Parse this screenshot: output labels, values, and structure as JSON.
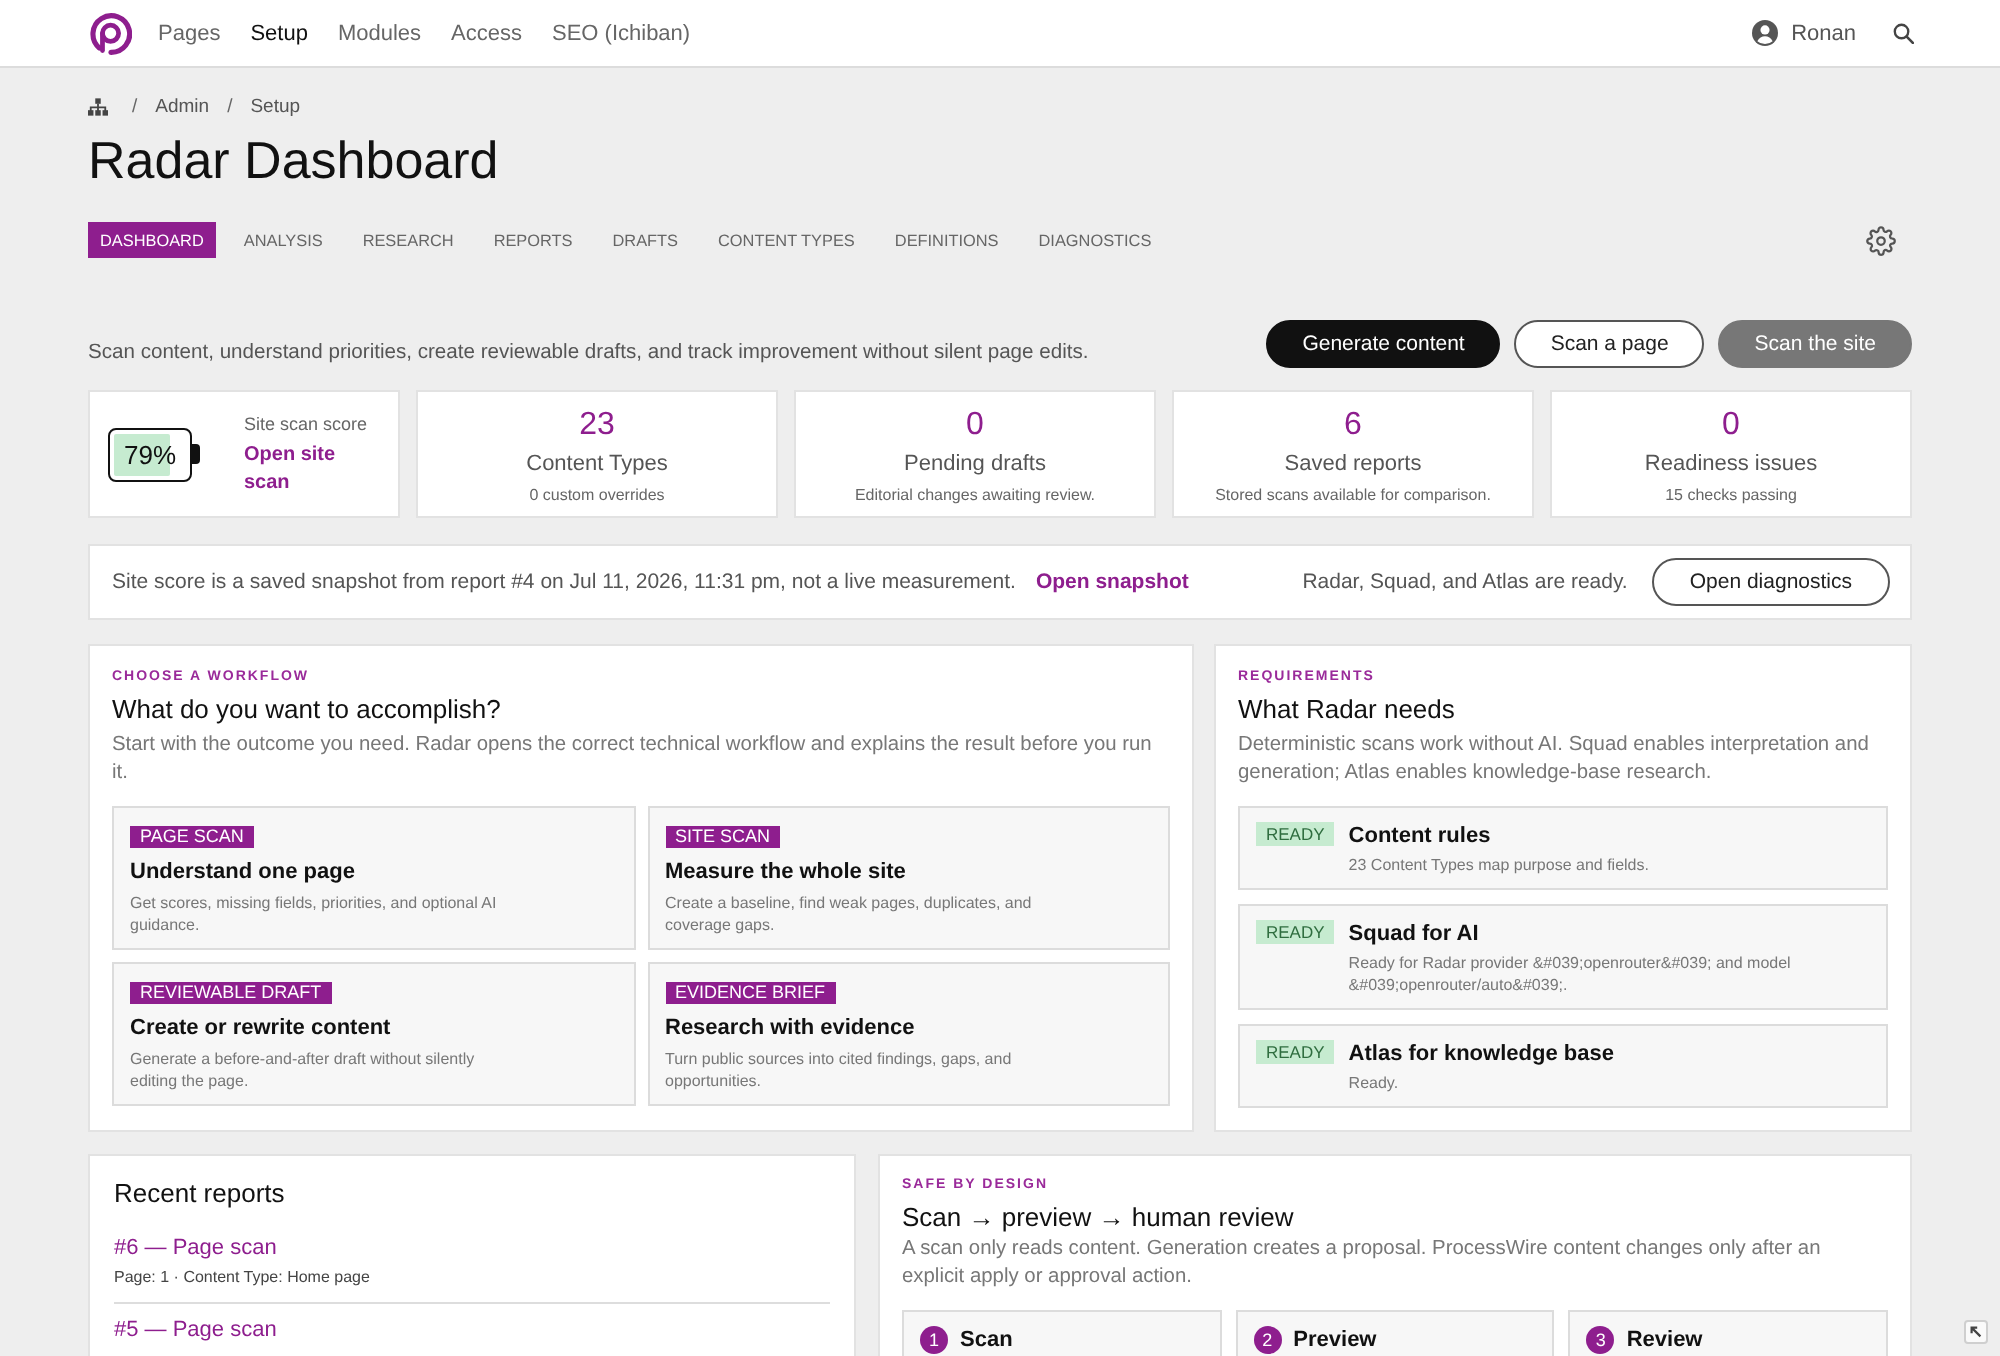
{
  "top_nav": {
    "items": [
      {
        "label": "Pages",
        "selected": false
      },
      {
        "label": "Setup",
        "selected": true
      },
      {
        "label": "Modules",
        "selected": false
      },
      {
        "label": "Access",
        "selected": false
      },
      {
        "label": "SEO (Ichiban)",
        "selected": false
      }
    ],
    "user": {
      "name": "Ronan"
    }
  },
  "breadcrumb": [
    {
      "separator": "/",
      "label": "Admin"
    },
    {
      "separator": "/",
      "label": "Setup"
    }
  ],
  "page_title": "Radar Dashboard",
  "tabs": [
    {
      "label": "DASHBOARD",
      "selected": true
    },
    {
      "label": "ANALYSIS",
      "selected": false
    },
    {
      "label": "RESEARCH",
      "selected": false
    },
    {
      "label": "REPORTS",
      "selected": false
    },
    {
      "label": "DRAFTS",
      "selected": false
    },
    {
      "label": "CONTENT TYPES",
      "selected": false
    },
    {
      "label": "DEFINITIONS",
      "selected": false
    },
    {
      "label": "DIAGNOSTICS",
      "selected": false
    }
  ],
  "intro": "Scan content, understand priorities, create reviewable drafts, and track improvement without silent page edits.",
  "actions": [
    {
      "label": "Generate content",
      "kind": "primary"
    },
    {
      "label": "Scan a page",
      "kind": "outline"
    },
    {
      "label": "Scan the site",
      "kind": "secondary"
    }
  ],
  "score_card": {
    "level": 0.79,
    "reading": "79%",
    "label": "Site scan score",
    "link": "Open site scan"
  },
  "stats": [
    {
      "value": "23",
      "label": "Content Types",
      "note": "0 custom overrides"
    },
    {
      "value": "0",
      "label": "Pending drafts",
      "note": "Editorial changes awaiting review."
    },
    {
      "value": "6",
      "label": "Saved reports",
      "note": "Stored scans available for comparison."
    },
    {
      "value": "0",
      "label": "Readiness issues",
      "note": "15 checks passing"
    }
  ],
  "snapshot_bar": {
    "message": "Site score is a saved snapshot from report #4 on Jul 11, 2026, 11:31 pm, not a live measurement.",
    "link": "Open snapshot",
    "status": "Radar, Squad, and Atlas are ready.",
    "button": "Open diagnostics"
  },
  "workflow": {
    "eyebrow": "CHOOSE A WORKFLOW",
    "heading": "What do you want to accomplish?",
    "description": "Start with the outcome you need. Radar opens the correct technical workflow and explains the result before you run it.",
    "options": [
      {
        "tag": "PAGE SCAN",
        "title": "Understand one page",
        "description": "Get scores, missing fields, priorities, and optional AI guidance."
      },
      {
        "tag": "SITE SCAN",
        "title": "Measure the whole site",
        "description": "Create a baseline, find weak pages, duplicates, and coverage gaps."
      },
      {
        "tag": "REVIEWABLE DRAFT",
        "title": "Create or rewrite content",
        "description": "Generate a before-and-after draft without silently editing the page."
      },
      {
        "tag": "EVIDENCE BRIEF",
        "title": "Research with evidence",
        "description": "Turn public sources into cited findings, gaps, and opportunities."
      }
    ]
  },
  "requirements": {
    "eyebrow": "REQUIREMENTS",
    "heading": "What Radar needs",
    "description": "Deterministic scans work without AI. Squad enables interpretation and generation; Atlas enables knowledge-base research.",
    "items": [
      {
        "status": "READY",
        "title": "Content rules",
        "description": "23 Content Types map purpose and fields."
      },
      {
        "status": "READY",
        "title": "Squad for AI",
        "description": "Ready for Radar provider &#039;openrouter&#039; and model &#039;openrouter/auto&#039;."
      },
      {
        "status": "READY",
        "title": "Atlas for knowledge base",
        "description": "Ready."
      }
    ]
  },
  "recent_reports": {
    "heading": "Recent reports",
    "reports": [
      {
        "title": "#6 — Page scan",
        "meta": "Page: 1 · Content Type: Home page"
      },
      {
        "title": "#5 — Page scan"
      }
    ]
  },
  "safe_by_design": {
    "eyebrow": "SAFE BY DESIGN",
    "heading": "Scan → preview → human review",
    "description": "A scan only reads content. Generation creates a proposal. ProcessWire content changes only after an explicit apply or approval action.",
    "steps": [
      {
        "number": "1",
        "title": "Scan"
      },
      {
        "number": "2",
        "title": "Preview"
      },
      {
        "number": "3",
        "title": "Review"
      }
    ]
  }
}
